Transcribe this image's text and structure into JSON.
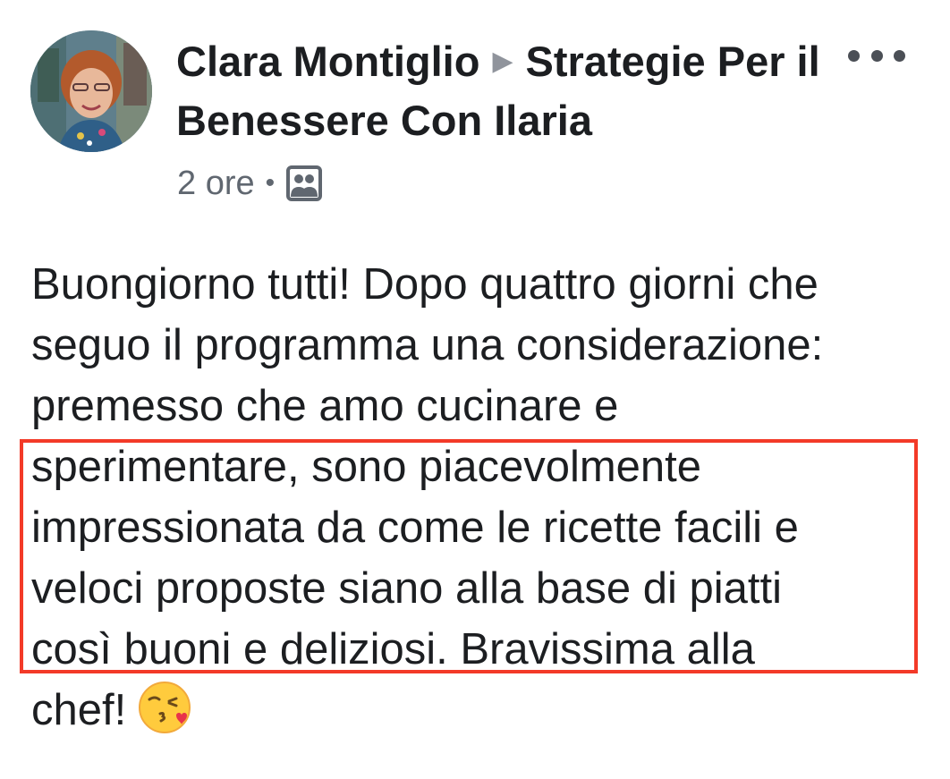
{
  "post": {
    "author": "Clara Montiglio",
    "group": "Strategie Per il Benessere Con Ilaria",
    "time": "2 ore",
    "separator": "•",
    "audience_icon": "group-audience-icon",
    "more_icon": "more-options-icon",
    "text_lines": [
      "Buongiorno tutti! Dopo quattro giorni che",
      "seguo il programma una considerazione:",
      "premesso che amo cucinare e",
      "sperimentare, sono piacevolmente",
      "impressionata da come le ricette facili e",
      "veloci proposte siano alla base di piatti",
      "così buoni e deliziosi. Bravissima alla",
      "chef!"
    ],
    "emoji": "kissing-face-with-heart-emoji"
  },
  "colors": {
    "highlight": "#f33a28",
    "text": "#1c1e21",
    "meta": "#606770",
    "arrow": "#90949c"
  }
}
